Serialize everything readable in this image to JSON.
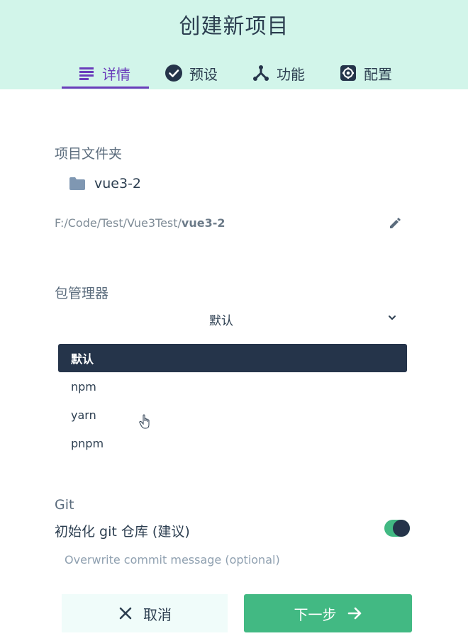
{
  "header": {
    "title": "创建新项目",
    "tabs": [
      {
        "label": "详情",
        "icon": "details-lines-icon",
        "active": true
      },
      {
        "label": "预设",
        "icon": "check-circle-icon",
        "active": false
      },
      {
        "label": "功能",
        "icon": "branch-icon",
        "active": false
      },
      {
        "label": "配置",
        "icon": "gear-icon",
        "active": false
      }
    ]
  },
  "project_folder": {
    "label": "项目文件夹",
    "folder_name": "vue3-2",
    "path_prefix": "F:/Code/Test/Vue3Test/",
    "path_bold": "vue3-2"
  },
  "package_manager": {
    "label": "包管理器",
    "selected": "默认",
    "options": [
      "默认",
      "npm",
      "yarn",
      "pnpm"
    ]
  },
  "git": {
    "label": "Git",
    "init_label": "初始化 git 仓库 (建议)",
    "init_enabled": true,
    "commit_placeholder": "Overwrite commit message (optional)",
    "commit_value": ""
  },
  "actions": {
    "cancel_label": "取消",
    "next_label": "下一步"
  },
  "colors": {
    "header_bg": "#d2f5ea",
    "accent_purple": "#6a3dbb",
    "primary_green": "#42b983",
    "dark_navy": "#25344a"
  }
}
